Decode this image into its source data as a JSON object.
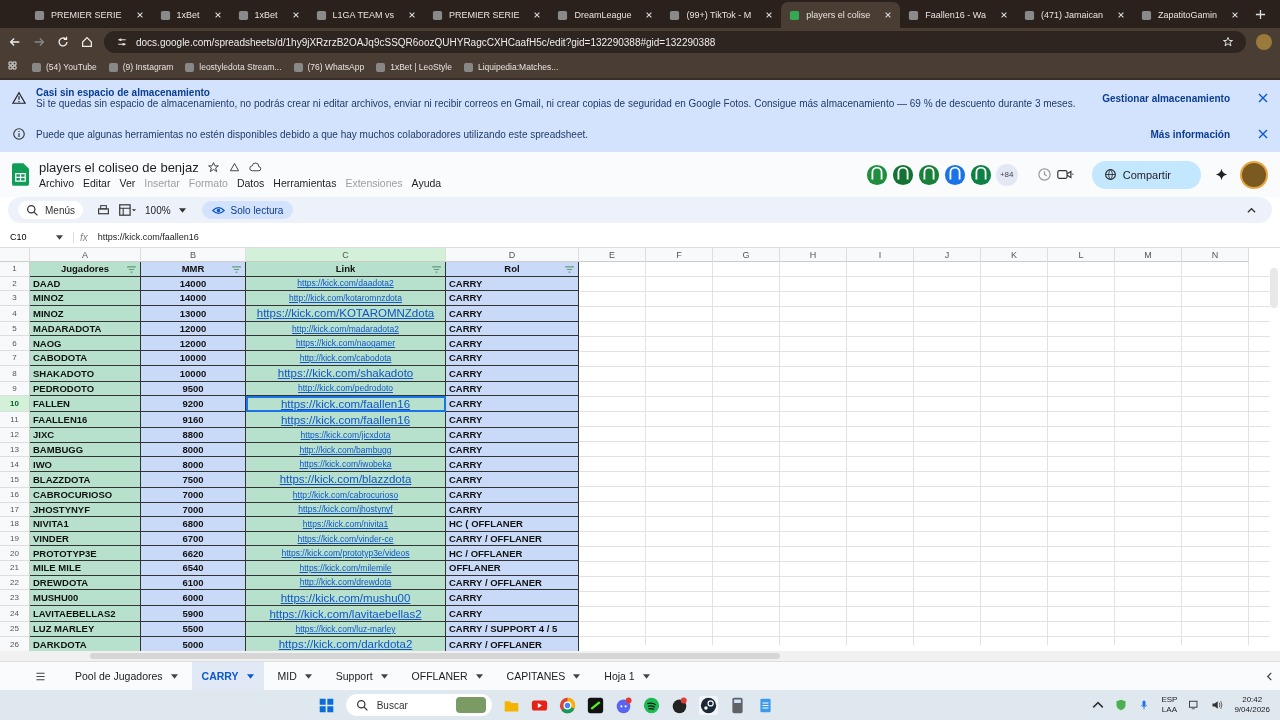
{
  "browser": {
    "tabs": [
      {
        "title": "PREMIER SERIE",
        "selected": false
      },
      {
        "title": "1xBet",
        "selected": false
      },
      {
        "title": "1xBet",
        "selected": false
      },
      {
        "title": "L1GA TEAM vs",
        "selected": false
      },
      {
        "title": "PREMIER SERIE",
        "selected": false
      },
      {
        "title": "DreamLeague",
        "selected": false
      },
      {
        "title": "(99+) TikTok - M",
        "selected": false
      },
      {
        "title": "players el colise",
        "selected": true
      },
      {
        "title": "Faallen16 - Wa",
        "selected": false
      },
      {
        "title": "(471) Jamaican",
        "selected": false
      },
      {
        "title": "ZapatitoGamin",
        "selected": false
      }
    ],
    "url": "docs.google.com/spreadsheets/d/1hy9jXRzrzB2OAJq9cSSQR6oozQUHYRagcCXHCaafH5c/edit?gid=132290388#gid=132290388",
    "bookmarks": [
      "(54) YouTube",
      "(9) Instagram",
      "leostyledota Stream...",
      "(76) WhatsApp",
      "1xBet | LeoStyle",
      "Liquipedia:Matches..."
    ]
  },
  "banners": [
    {
      "kind": "warning",
      "title": "Casi sin espacio de almacenamiento",
      "text": "Si te quedas sin espacio de almacenamiento, no podrás crear ni editar archivos, enviar ni recibir correos en Gmail, ni crear copias de seguridad en Google Fotos. Consigue más almacenamiento — 69 % de descuento durante 3 meses.",
      "action": "Gestionar almacenamiento"
    },
    {
      "kind": "info",
      "text": "Puede que algunas herramientas no estén disponibles debido a que hay muchos colaboradores utilizando este spreadsheet.",
      "action": "Más información"
    }
  ],
  "doc": {
    "title": "players el coliseo de benjaz",
    "menus": [
      {
        "label": "Archivo",
        "disabled": false
      },
      {
        "label": "Editar",
        "disabled": false
      },
      {
        "label": "Ver",
        "disabled": false
      },
      {
        "label": "Insertar",
        "disabled": true
      },
      {
        "label": "Formato",
        "disabled": true
      },
      {
        "label": "Datos",
        "disabled": false
      },
      {
        "label": "Herramientas",
        "disabled": false
      },
      {
        "label": "Extensiones",
        "disabled": true
      },
      {
        "label": "Ayuda",
        "disabled": false
      }
    ],
    "more_collaborators": "+84",
    "share": "Compartir"
  },
  "toolbar": {
    "search": "Menús",
    "zoom": "100%",
    "mode": "Solo lectura"
  },
  "formula_bar": {
    "cell": "C10",
    "fx_label": "fx",
    "value": "https://kick.com/faallen16"
  },
  "column_letters": [
    "A",
    "B",
    "C",
    "D",
    "E",
    "F",
    "G",
    "H",
    "I",
    "J",
    "K",
    "L",
    "M",
    "N"
  ],
  "header_row": {
    "n": "1",
    "cells": [
      "Jugadores",
      "MMR",
      "Link",
      "Rol"
    ]
  },
  "rows": [
    {
      "n": "2",
      "player": "DAAD",
      "mmr": "14000",
      "link": "https://kick.com/daadota2",
      "large": false,
      "selected": false,
      "role": "CARRY"
    },
    {
      "n": "3",
      "player": "MINOZ",
      "mmr": "14000",
      "link": "http://kick.com/kotaromnzdota",
      "large": false,
      "selected": false,
      "role": "CARRY"
    },
    {
      "n": "4",
      "player": "MINOZ",
      "mmr": "13000",
      "link": "https://kick.com/KOTAROMNZdota",
      "large": true,
      "selected": false,
      "role": "CARRY"
    },
    {
      "n": "5",
      "player": "MADARADOTA",
      "mmr": "12000",
      "link": "http://kick.com/madaradota2",
      "large": false,
      "selected": false,
      "role": "CARRY"
    },
    {
      "n": "6",
      "player": "NAOG",
      "mmr": "12000",
      "link": "https://kick.com/naogamer",
      "large": false,
      "selected": false,
      "role": "CARRY"
    },
    {
      "n": "7",
      "player": "CABODOTA",
      "mmr": "10000",
      "link": "http://kick.com/cabodota",
      "large": false,
      "selected": false,
      "role": "CARRY"
    },
    {
      "n": "8",
      "player": "SHAKADOTO",
      "mmr": "10000",
      "link": "https://kick.com/shakadoto",
      "large": true,
      "selected": false,
      "role": "CARRY"
    },
    {
      "n": "9",
      "player": "PEDRODOTO",
      "mmr": "9500",
      "link": "http://kick.com/pedrodoto",
      "large": false,
      "selected": false,
      "role": "CARRY"
    },
    {
      "n": "10",
      "player": "FALLEN",
      "mmr": "9200",
      "link": "https://kick.com/faallen16",
      "large": true,
      "selected": true,
      "role": "CARRY"
    },
    {
      "n": "11",
      "player": "FAALLEN16",
      "mmr": "9160",
      "link": "https://kick.com/faallen16",
      "large": true,
      "selected": false,
      "role": "CARRY"
    },
    {
      "n": "12",
      "player": "JIXC",
      "mmr": "8800",
      "link": "https://kick.com/jicxdota",
      "large": false,
      "selected": false,
      "role": "CARRY"
    },
    {
      "n": "13",
      "player": "BAMBUGG",
      "mmr": "8000",
      "link": "http://kick.com/bambugg",
      "large": false,
      "selected": false,
      "role": "CARRY"
    },
    {
      "n": "14",
      "player": "IWO",
      "mmr": "8000",
      "link": "https://kick.com/iwobeka",
      "large": false,
      "selected": false,
      "role": "CARRY"
    },
    {
      "n": "15",
      "player": "BLAZZDOTA",
      "mmr": "7500",
      "link": "https://kick.com/blazzdota",
      "large": true,
      "selected": false,
      "role": "CARRY"
    },
    {
      "n": "16",
      "player": "CABROCURIOSO",
      "mmr": "7000",
      "link": "http://kick.com/cabrocurioso",
      "large": false,
      "selected": false,
      "role": "CARRY"
    },
    {
      "n": "17",
      "player": "JHOSTYNYF",
      "mmr": "7000",
      "link": "https://kick.com/jhostynyf",
      "large": false,
      "selected": false,
      "role": "CARRY"
    },
    {
      "n": "18",
      "player": "NIVITA1",
      "mmr": "6800",
      "link": "https://kick.com/nivita1",
      "large": false,
      "selected": false,
      "role": "HC ( OFFLANER"
    },
    {
      "n": "19",
      "player": "VINDER",
      "mmr": "6700",
      "link": "https://kick.com/vinder-ce",
      "large": false,
      "selected": false,
      "role": "CARRY / OFFLANER"
    },
    {
      "n": "20",
      "player": "PROTOTYP3E",
      "mmr": "6620",
      "link": "https://kick.com/prototyp3e/videos",
      "large": false,
      "selected": false,
      "role": "HC / OFFLANER"
    },
    {
      "n": "21",
      "player": "MILE MILE",
      "mmr": "6540",
      "link": "https://kick.com/milemile",
      "large": false,
      "selected": false,
      "role": "OFFLANER"
    },
    {
      "n": "22",
      "player": "DREWDOTA",
      "mmr": "6100",
      "link": "http://kick.com/drewdota",
      "large": false,
      "selected": false,
      "role": "CARRY / OFFLANER"
    },
    {
      "n": "23",
      "player": "MUSHU00",
      "mmr": "6000",
      "link": "https://kick.com/mushu00",
      "large": true,
      "selected": false,
      "role": "CARRY"
    },
    {
      "n": "24",
      "player": "LAVITAEBELLAS2",
      "mmr": "5900",
      "link": "https://kick.com/lavitaebellas2",
      "large": true,
      "selected": false,
      "role": "CARRY"
    },
    {
      "n": "25",
      "player": "LUZ MARLEY",
      "mmr": "5500",
      "link": "https://kick.com/luz-marley",
      "large": false,
      "selected": false,
      "role": "CARRY / SUPPORT 4 / 5"
    },
    {
      "n": "26",
      "player": "DARKDOTA",
      "mmr": "5000",
      "link": "https://kick.com/darkdota2",
      "large": true,
      "selected": false,
      "role": "CARRY / OFFLANER"
    }
  ],
  "sheet_tabs": [
    {
      "label": "Pool de Jugadores",
      "selected": false
    },
    {
      "label": "CARRY",
      "selected": true
    },
    {
      "label": "MID",
      "selected": false
    },
    {
      "label": "Support",
      "selected": false
    },
    {
      "label": "OFFLANER",
      "selected": false
    },
    {
      "label": "CAPITANES",
      "selected": false
    },
    {
      "label": "Hoja 1",
      "selected": false
    }
  ],
  "taskbar": {
    "search": "Buscar",
    "language": "ESP",
    "layout": "LAA",
    "time": "20:42",
    "date": "9/04/2026"
  }
}
